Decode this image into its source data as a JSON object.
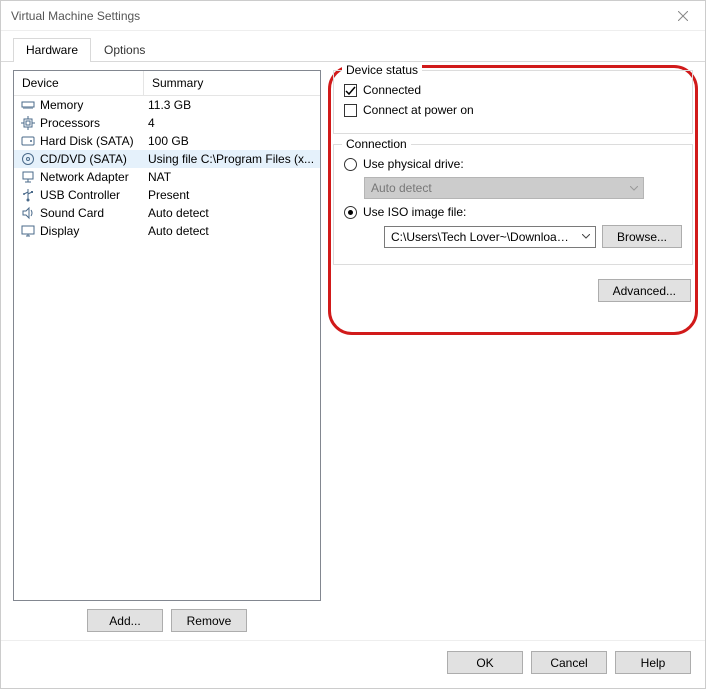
{
  "window": {
    "title": "Virtual Machine Settings"
  },
  "tabs": {
    "hardware": "Hardware",
    "options": "Options"
  },
  "list": {
    "header_device": "Device",
    "header_summary": "Summary",
    "items": [
      {
        "label": "Memory",
        "summary": "11.3 GB",
        "icon": "memory"
      },
      {
        "label": "Processors",
        "summary": "4",
        "icon": "cpu"
      },
      {
        "label": "Hard Disk (SATA)",
        "summary": "100 GB",
        "icon": "hdd"
      },
      {
        "label": "CD/DVD (SATA)",
        "summary": "Using file C:\\Program Files (x...",
        "icon": "cd"
      },
      {
        "label": "Network Adapter",
        "summary": "NAT",
        "icon": "net"
      },
      {
        "label": "USB Controller",
        "summary": "Present",
        "icon": "usb"
      },
      {
        "label": "Sound Card",
        "summary": "Auto detect",
        "icon": "sound"
      },
      {
        "label": "Display",
        "summary": "Auto detect",
        "icon": "display"
      }
    ],
    "selected_index": 3,
    "add_label": "Add...",
    "remove_label": "Remove"
  },
  "status": {
    "legend": "Device status",
    "connected_label": "Connected",
    "connected_checked": true,
    "poweron_label": "Connect at power on",
    "poweron_checked": false
  },
  "connection": {
    "legend": "Connection",
    "physical_label": "Use physical drive:",
    "physical_selected": false,
    "physical_combo": "Auto detect",
    "iso_label": "Use ISO image file:",
    "iso_selected": true,
    "iso_path": "C:\\Users\\Tech Lover~\\Downloads\\VM Tool",
    "browse_label": "Browse..."
  },
  "advanced_label": "Advanced...",
  "buttons": {
    "ok": "OK",
    "cancel": "Cancel",
    "help": "Help"
  }
}
